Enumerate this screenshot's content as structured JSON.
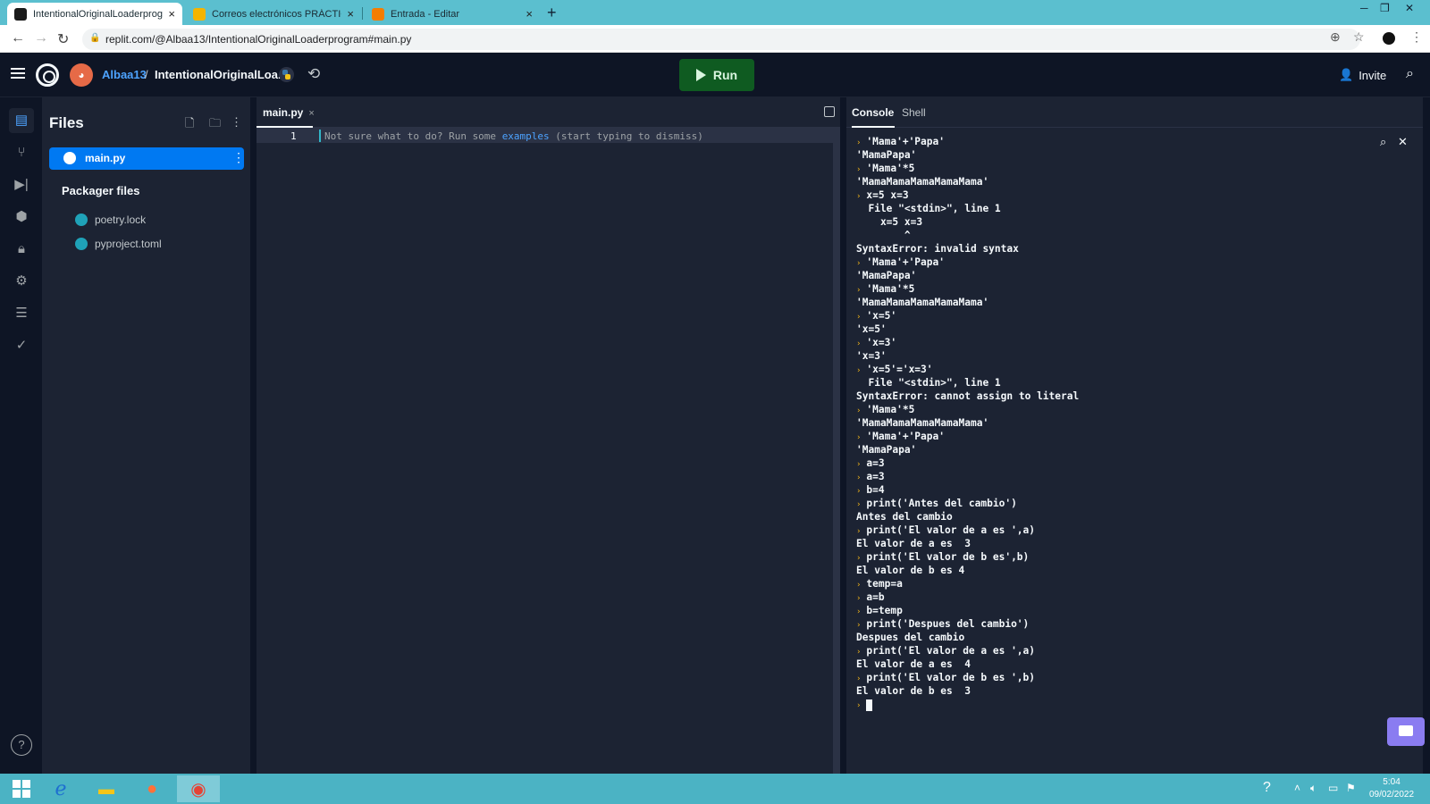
{
  "browser": {
    "tabs": [
      {
        "title": "IntentionalOriginalLoaderprogra",
        "active": true,
        "favicon_color": "#1a1a1a"
      },
      {
        "title": "Correos electrónicos PRÁCTICAS",
        "active": false,
        "favicon_color": "#f4b400"
      },
      {
        "title": "Entrada - Editar",
        "active": false,
        "favicon_color": "#f57d00"
      }
    ],
    "tab_close": "×",
    "new_tab": "+",
    "url": "replit.com/@Albaa13/IntentionalOriginalLoaderprogram#main.py"
  },
  "header": {
    "username": "Albaa13",
    "separator": "/",
    "repl_name": "IntentionalOriginalLoa...",
    "run_label": "Run",
    "invite_label": "Invite"
  },
  "sidebar": {
    "icons": [
      "files-icon",
      "version-control-icon",
      "debugger-icon",
      "packages-icon",
      "secrets-icon",
      "settings-icon",
      "database-icon",
      "unit-tests-icon"
    ],
    "help_label": "?"
  },
  "files": {
    "title": "Files",
    "selected_file": "main.py",
    "packager_title": "Packager files",
    "packager_files": [
      "poetry.lock",
      "pyproject.toml"
    ]
  },
  "editor": {
    "tab_label": "main.py",
    "tab_close": "×",
    "line_number": "1",
    "hint_before": "Not sure what to do? Run some ",
    "hint_link": "examples",
    "hint_after": " (start typing to dismiss)"
  },
  "console": {
    "tabs": [
      "Console",
      "Shell"
    ],
    "lines": [
      {
        "prompt": true,
        "text": "'Mama'+'Papa'"
      },
      {
        "prompt": false,
        "text": "'MamaPapa'"
      },
      {
        "prompt": true,
        "text": "'Mama'*5"
      },
      {
        "prompt": false,
        "text": "'MamaMamaMamaMamaMama'"
      },
      {
        "prompt": true,
        "text": "x=5 x=3"
      },
      {
        "prompt": false,
        "text": "  File \"<stdin>\", line 1"
      },
      {
        "prompt": false,
        "text": "    x=5 x=3"
      },
      {
        "prompt": false,
        "text": "        ^"
      },
      {
        "prompt": false,
        "text": "SyntaxError: invalid syntax"
      },
      {
        "prompt": true,
        "text": "'Mama'+'Papa'"
      },
      {
        "prompt": false,
        "text": "'MamaPapa'"
      },
      {
        "prompt": true,
        "text": "'Mama'*5"
      },
      {
        "prompt": false,
        "text": "'MamaMamaMamaMamaMama'"
      },
      {
        "prompt": true,
        "text": "'x=5'"
      },
      {
        "prompt": false,
        "text": "'x=5'"
      },
      {
        "prompt": true,
        "text": "'x=3'"
      },
      {
        "prompt": false,
        "text": "'x=3'"
      },
      {
        "prompt": true,
        "text": "'x=5'='x=3'"
      },
      {
        "prompt": false,
        "text": "  File \"<stdin>\", line 1"
      },
      {
        "prompt": false,
        "text": "SyntaxError: cannot assign to literal"
      },
      {
        "prompt": true,
        "text": "'Mama'*5"
      },
      {
        "prompt": false,
        "text": "'MamaMamaMamaMamaMama'"
      },
      {
        "prompt": true,
        "text": "'Mama'+'Papa'"
      },
      {
        "prompt": false,
        "text": "'MamaPapa'"
      },
      {
        "prompt": true,
        "text": "a=3"
      },
      {
        "prompt": true,
        "text": "a=3"
      },
      {
        "prompt": true,
        "text": "b=4"
      },
      {
        "prompt": true,
        "text": "print('Antes del cambio')"
      },
      {
        "prompt": false,
        "text": "Antes del cambio"
      },
      {
        "prompt": true,
        "text": "print('El valor de a es ',a)"
      },
      {
        "prompt": false,
        "text": "El valor de a es  3"
      },
      {
        "prompt": true,
        "text": "print('El valor de b es',b)"
      },
      {
        "prompt": false,
        "text": "El valor de b es 4"
      },
      {
        "prompt": true,
        "text": "temp=a"
      },
      {
        "prompt": true,
        "text": "a=b"
      },
      {
        "prompt": true,
        "text": "b=temp"
      },
      {
        "prompt": true,
        "text": "print('Despues del cambio')"
      },
      {
        "prompt": false,
        "text": "Despues del cambio"
      },
      {
        "prompt": true,
        "text": "print('El valor de a es ',a)"
      },
      {
        "prompt": false,
        "text": "El valor de a es  4"
      },
      {
        "prompt": true,
        "text": "print('El valor de b es ',b)"
      },
      {
        "prompt": false,
        "text": "El valor de b es  3"
      }
    ],
    "prompt_glyph": "›"
  },
  "taskbar": {
    "apps": [
      "windows-start",
      "internet-explorer",
      "file-explorer",
      "firefox",
      "chrome"
    ],
    "time": "5:04",
    "date": "09/02/2022"
  },
  "colors": {
    "accent": "#0079f2",
    "run_green": "#0f5b21",
    "prompt": "#f2b517",
    "bg": "#0e1525",
    "panel": "#1c2333"
  }
}
